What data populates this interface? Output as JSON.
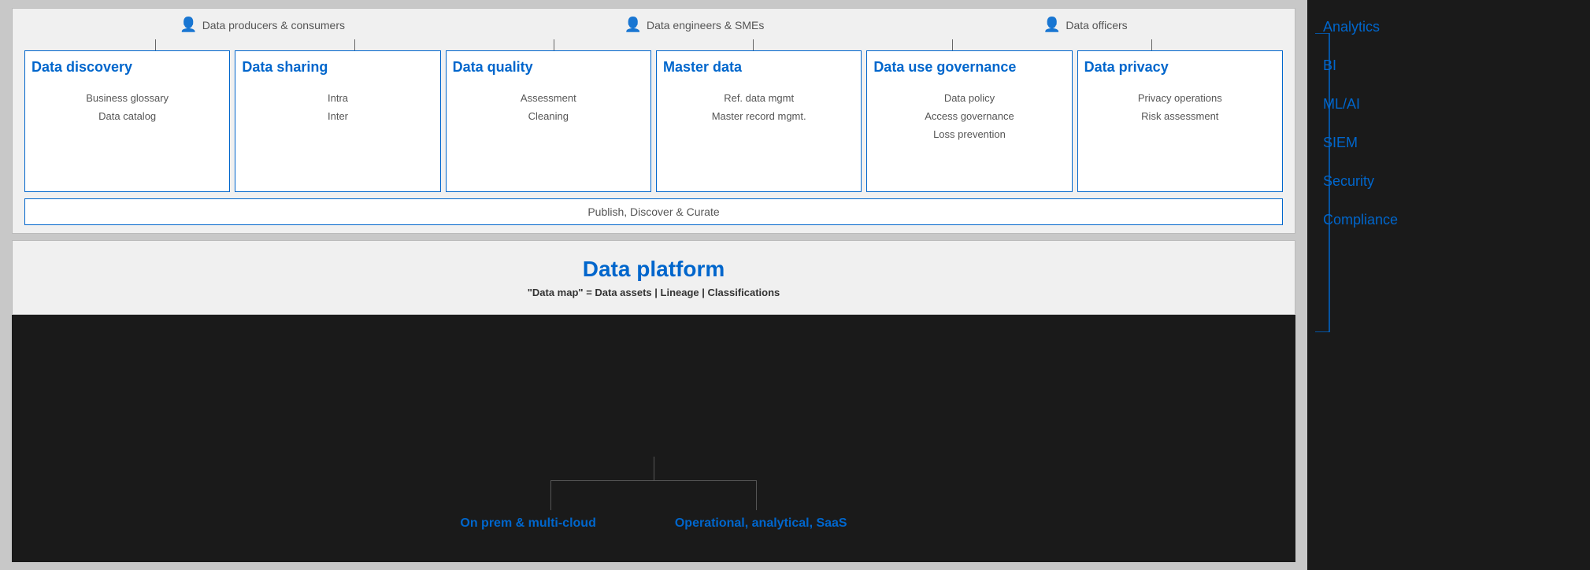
{
  "personas": [
    {
      "label": "Data producers & consumers"
    },
    {
      "label": "Data engineers & SMEs"
    },
    {
      "label": "Data officers"
    }
  ],
  "capability_boxes": [
    {
      "title": "Data discovery",
      "items": [
        "Business glossary",
        "Data catalog"
      ]
    },
    {
      "title": "Data sharing",
      "items": [
        "Intra",
        "Inter"
      ]
    },
    {
      "title": "Data quality",
      "items": [
        "Assessment",
        "Cleaning"
      ]
    },
    {
      "title": "Master data",
      "items": [
        "Ref. data mgmt",
        "Master record mgmt."
      ]
    },
    {
      "title": "Data use governance",
      "items": [
        "Data policy",
        "Access governance",
        "Loss prevention"
      ]
    },
    {
      "title": "Data privacy",
      "items": [
        "Privacy operations",
        "Risk assessment"
      ]
    }
  ],
  "publish_bar": "Publish, Discover & Curate",
  "data_platform": {
    "title": "Data platform",
    "subtitle": "\"Data map\" = Data assets | Lineage | Classifications"
  },
  "sources": [
    {
      "label": "On prem & multi-cloud"
    },
    {
      "label": "Operational, analytical, SaaS"
    }
  ],
  "sidebar_items": [
    {
      "label": "Analytics"
    },
    {
      "label": "BI"
    },
    {
      "label": "ML/AI"
    },
    {
      "label": "SIEM"
    },
    {
      "label": "Security"
    },
    {
      "label": "Compliance"
    }
  ]
}
